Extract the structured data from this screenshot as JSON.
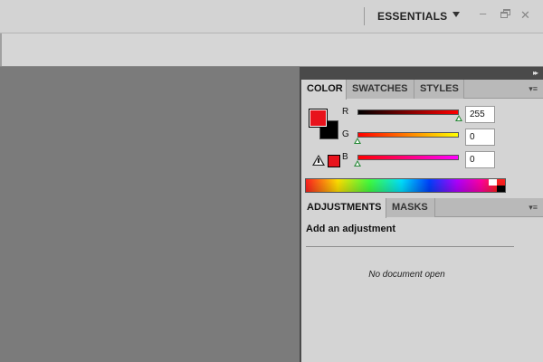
{
  "titlebar": {
    "workspace_label": "ESSENTIALS",
    "icons": {
      "workspace_menu": "chevron-down-icon",
      "minimize": "minimize-icon",
      "restore": "restore-icon",
      "close": "close-icon"
    },
    "glyphs": {
      "minimize": "–",
      "close": "✕"
    }
  },
  "dock": {
    "collapse_glyph": "▸▸",
    "color_panel": {
      "tabs": [
        {
          "label": "COLOR",
          "active": true
        },
        {
          "label": "SWATCHES",
          "active": false
        },
        {
          "label": "STYLES",
          "active": false
        }
      ],
      "menu_glyph": "▾≡",
      "foreground_color": "#e8131c",
      "background_color": "#000000",
      "channels": [
        {
          "label": "R",
          "value": "255",
          "level": 1.0
        },
        {
          "label": "G",
          "value": "0",
          "level": 0.0
        },
        {
          "label": "B",
          "value": "0",
          "level": 0.0
        }
      ],
      "gamut_warning_color": "#e8131c"
    },
    "adjustments_panel": {
      "tabs": [
        {
          "label": "ADJUSTMENTS",
          "active": true
        },
        {
          "label": "MASKS",
          "active": false
        }
      ],
      "menu_glyph": "▾≡",
      "heading": "Add an adjustment",
      "empty_message": "No document open"
    }
  },
  "colors": {
    "canvas": "#7b7b7b",
    "panel": "#d4d4d4",
    "dock_header": "#4a4a4a",
    "accent_red": "#e8131c"
  }
}
